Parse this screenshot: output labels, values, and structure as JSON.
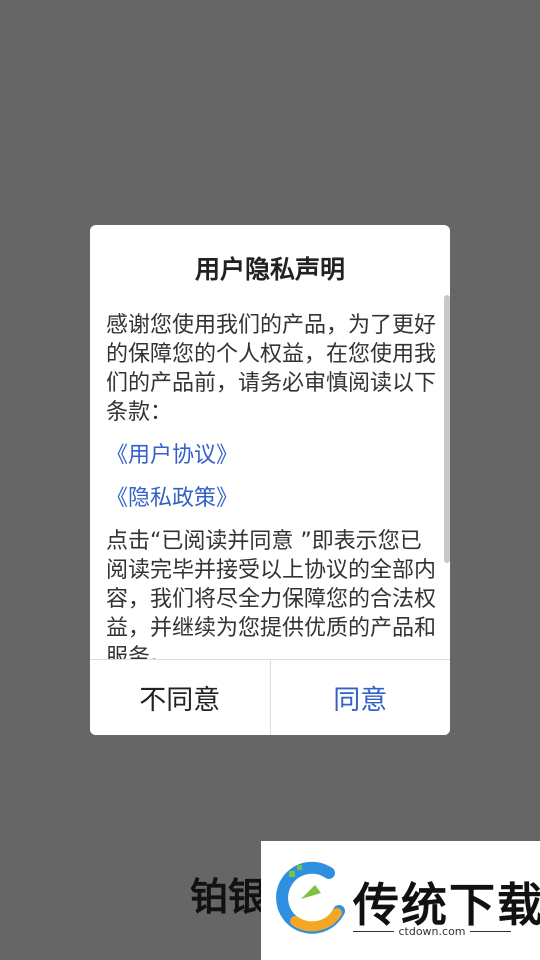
{
  "dialog": {
    "title": "用户隐私声明",
    "intro": "感谢您使用我们的产品，为了更好的保障您的个人权益，在您使用我们的产品前，请务必审慎阅读以下条款：",
    "links": [
      "《用户协议》",
      "《隐私政策》"
    ],
    "outro": "点击“已阅读并同意 ”即表示您已阅读完毕并接受以上协议的全部内容，我们将尽全力保障您的合法权益，并继续为您提供优质的产品和服务。",
    "disagree_label": "不同意",
    "agree_label": "同意"
  },
  "background": {
    "app_title_partial": "铂银"
  },
  "watermark": {
    "name": "传统下载",
    "url": "ctdown.com"
  },
  "colors": {
    "overlay": "#666666",
    "link": "#3461c9",
    "agree": "#3461c9"
  }
}
